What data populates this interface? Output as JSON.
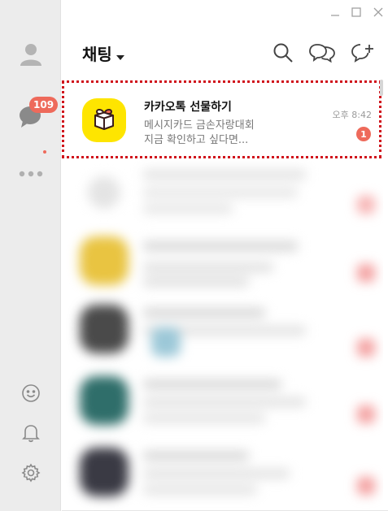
{
  "window": {
    "controls": [
      "minimize-icon",
      "maximize-icon",
      "close-icon"
    ]
  },
  "sidebar": {
    "items": [
      {
        "name": "friends",
        "icon": "person-icon"
      },
      {
        "name": "chats",
        "icon": "chat-bubble-icon",
        "badge": "109"
      },
      {
        "name": "more",
        "icon": "more-dots-icon"
      }
    ],
    "bottom_items": [
      {
        "name": "emoticon",
        "icon": "smiley-icon"
      },
      {
        "name": "notifications",
        "icon": "bell-icon"
      },
      {
        "name": "settings",
        "icon": "gear-icon"
      }
    ],
    "dot_color": "#ee6a5b"
  },
  "header": {
    "title": "채팅",
    "icons": [
      "search-icon",
      "open-chat-icon",
      "new-chat-icon"
    ]
  },
  "chats": [
    {
      "name": "카카오톡 선물하기",
      "preview_line1": "메시지카드 금손자랑대회",
      "preview_line2": "지금 확인하고 싶다면...",
      "time": "오후 8:42",
      "unread": "1",
      "avatar_color": "#fee500",
      "avatar_icon": "gift-box-icon",
      "highlighted": true
    }
  ],
  "colors": {
    "accent": "#ee6a5b",
    "highlight_border": "#d0121b",
    "sidebar_bg": "#ececec"
  }
}
